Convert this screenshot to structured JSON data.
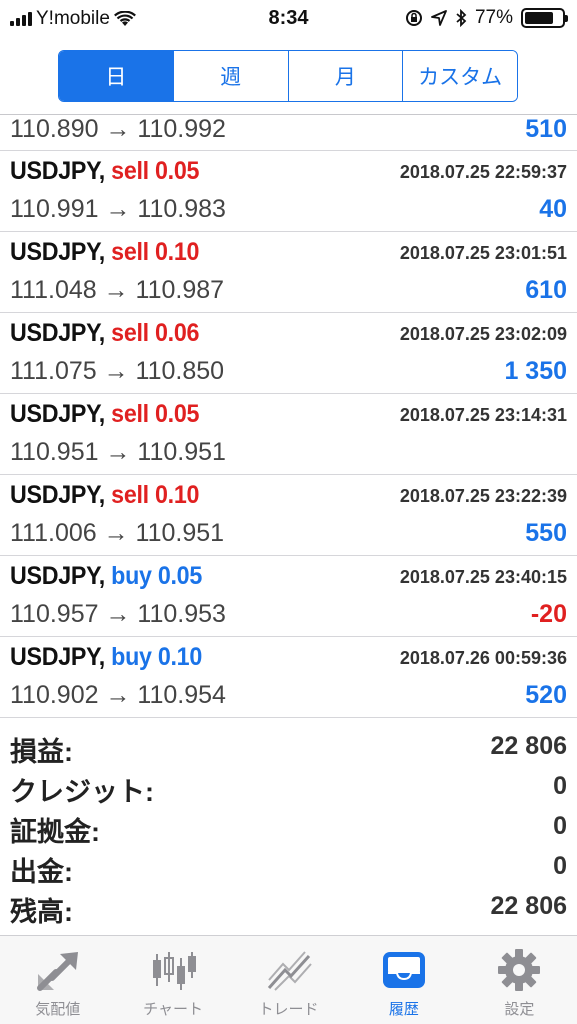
{
  "status_bar": {
    "carrier": "Y!mobile",
    "time": "8:34",
    "battery": "77%",
    "battery_level": 0.77
  },
  "segments": [
    {
      "label": "日",
      "active": true
    },
    {
      "label": "週",
      "active": false
    },
    {
      "label": "月",
      "active": false
    },
    {
      "label": "カスタム",
      "active": false
    }
  ],
  "partial_row": {
    "prices": "110.890 → 110.992",
    "profit": "510"
  },
  "trades": [
    {
      "symbol": "USDJPY,",
      "side": "sell 0.05",
      "type": "sell",
      "datetime": "2018.07.25 22:59:37",
      "prices": "110.991 → 110.983",
      "profit": "40",
      "sign": "pos"
    },
    {
      "symbol": "USDJPY,",
      "side": "sell 0.10",
      "type": "sell",
      "datetime": "2018.07.25 23:01:51",
      "prices": "111.048 → 110.987",
      "profit": "610",
      "sign": "pos"
    },
    {
      "symbol": "USDJPY,",
      "side": "sell 0.06",
      "type": "sell",
      "datetime": "2018.07.25 23:02:09",
      "prices": "111.075 → 110.850",
      "profit": "1 350",
      "sign": "pos"
    },
    {
      "symbol": "USDJPY,",
      "side": "sell 0.05",
      "type": "sell",
      "datetime": "2018.07.25 23:14:31",
      "prices": "110.951 → 110.951",
      "profit": "",
      "sign": "pos"
    },
    {
      "symbol": "USDJPY,",
      "side": "sell 0.10",
      "type": "sell",
      "datetime": "2018.07.25 23:22:39",
      "prices": "111.006 → 110.951",
      "profit": "550",
      "sign": "pos"
    },
    {
      "symbol": "USDJPY,",
      "side": "buy 0.05",
      "type": "buy",
      "datetime": "2018.07.25 23:40:15",
      "prices": "110.957 → 110.953",
      "profit": "-20",
      "sign": "neg"
    },
    {
      "symbol": "USDJPY,",
      "side": "buy 0.10",
      "type": "buy",
      "datetime": "2018.07.26 00:59:36",
      "prices": "110.902 → 110.954",
      "profit": "520",
      "sign": "pos"
    }
  ],
  "summary": {
    "profit_label": "損益:",
    "profit_value": "22 806",
    "credit_label": "クレジット:",
    "credit_value": "0",
    "deposit_label": "証拠金:",
    "deposit_value": "0",
    "withdrawal_label": "出金:",
    "withdrawal_value": "0",
    "balance_label": "残高:",
    "balance_value": "22 806"
  },
  "tabbar": [
    {
      "label": "気配値",
      "icon": "quotes-arrows-icon",
      "active": false
    },
    {
      "label": "チャート",
      "icon": "candlestick-chart-icon",
      "active": false
    },
    {
      "label": "トレード",
      "icon": "trade-chart-icon",
      "active": false
    },
    {
      "label": "履歴",
      "icon": "history-inbox-icon",
      "active": true
    },
    {
      "label": "設定",
      "icon": "gear-icon",
      "active": false
    }
  ],
  "colors": {
    "accent": "#1a73e8",
    "sell": "#e02020",
    "inactive_tab": "#8e8e93"
  }
}
